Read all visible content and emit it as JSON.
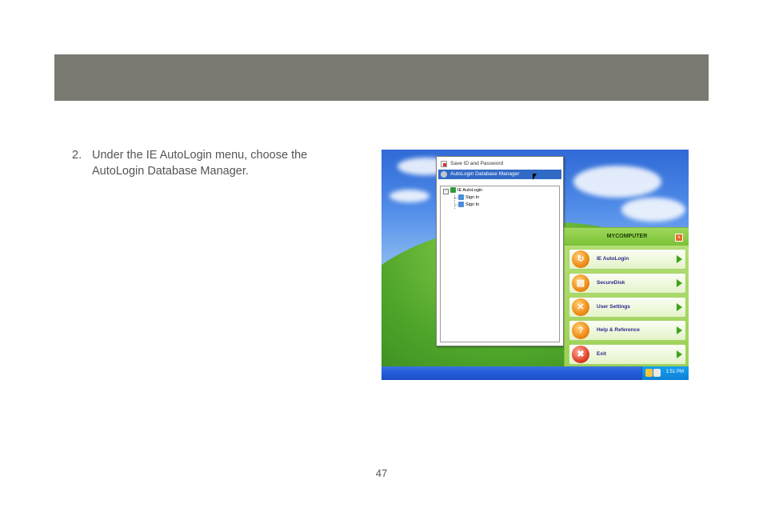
{
  "step": {
    "number": "2.",
    "text": "Under the IE AutoLogin menu, choose the AutoLogin Database Manager."
  },
  "page_number": "47",
  "screenshot": {
    "menu": {
      "items": [
        {
          "label": "Save ID and Password",
          "icon": "document-key-icon"
        },
        {
          "label": "AutoLogin Database Manager",
          "icon": "database-icon",
          "selected": true
        }
      ],
      "tree": {
        "root": "IE AutoLogin",
        "children": [
          "Sign In",
          "Sign In"
        ]
      }
    },
    "mycomputer": {
      "title": "MYCOMPUTER",
      "close_glyph": "x",
      "buttons": [
        {
          "label": "IE AutoLogin",
          "icon": "ie-autologin-icon",
          "glyph": "↻"
        },
        {
          "label": "SecureDisk",
          "icon": "folder-icon",
          "glyph": "▤"
        },
        {
          "label": "User Settings",
          "icon": "tools-icon",
          "glyph": "✕"
        },
        {
          "label": "Help & Reference",
          "icon": "help-icon",
          "glyph": "?"
        },
        {
          "label": "Exit",
          "icon": "exit-icon",
          "glyph": "✖"
        }
      ]
    },
    "taskbar": {
      "clock": "1:51 PM"
    }
  }
}
